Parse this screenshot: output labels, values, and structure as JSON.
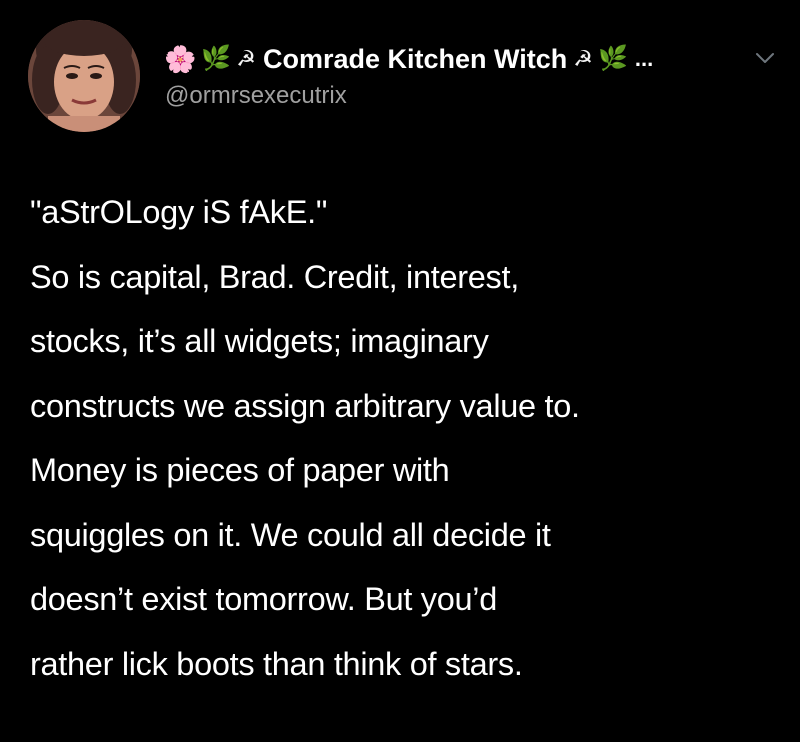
{
  "tweet": {
    "author": {
      "name_prefix_emojis": [
        "🌸",
        "🌿",
        "☭"
      ],
      "display_name": "Comrade Kitchen Witch",
      "name_suffix_emojis": [
        "☭",
        "🌿"
      ],
      "ellipsis": "...",
      "handle": "@ormrsexecutrix"
    },
    "icons": {
      "avatar": "profile-photo",
      "menu": "chevron-down-icon"
    },
    "lines": [
      "\"aStrOLogy iS fAkE.\"",
      "So is capital, Brad. Credit, interest,",
      "stocks, it’s all widgets; imaginary",
      "constructs we assign arbitrary value to.",
      "Money is pieces of paper with",
      "squiggles on it. We could all decide it",
      "doesn’t exist tomorrow. But you’d",
      "rather lick boots than think of stars."
    ],
    "colors": {
      "background": "#000000",
      "text": "#ffffff",
      "handle": "#a0a0a0"
    }
  }
}
